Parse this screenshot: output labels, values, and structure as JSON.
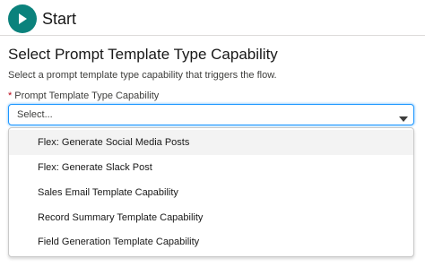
{
  "header": {
    "title": "Start",
    "icon": "play-icon",
    "icon_color": "#0b827c"
  },
  "section": {
    "title": "Select Prompt Template Type Capability",
    "description": "Select a prompt template type capability that triggers the flow."
  },
  "field": {
    "required_marker": "*",
    "label": "Prompt Template Type Capability",
    "placeholder": "Select...",
    "caret_icon": "caret-down-icon",
    "focus_color": "#1b96ff"
  },
  "dropdown": {
    "options": [
      {
        "label": "Flex: Generate Social Media Posts",
        "highlighted": true
      },
      {
        "label": "Flex: Generate Slack Post",
        "highlighted": false
      },
      {
        "label": "Sales Email Template Capability",
        "highlighted": false
      },
      {
        "label": "Record Summary Template Capability",
        "highlighted": false
      },
      {
        "label": "Field Generation Template Capability",
        "highlighted": false
      }
    ]
  }
}
